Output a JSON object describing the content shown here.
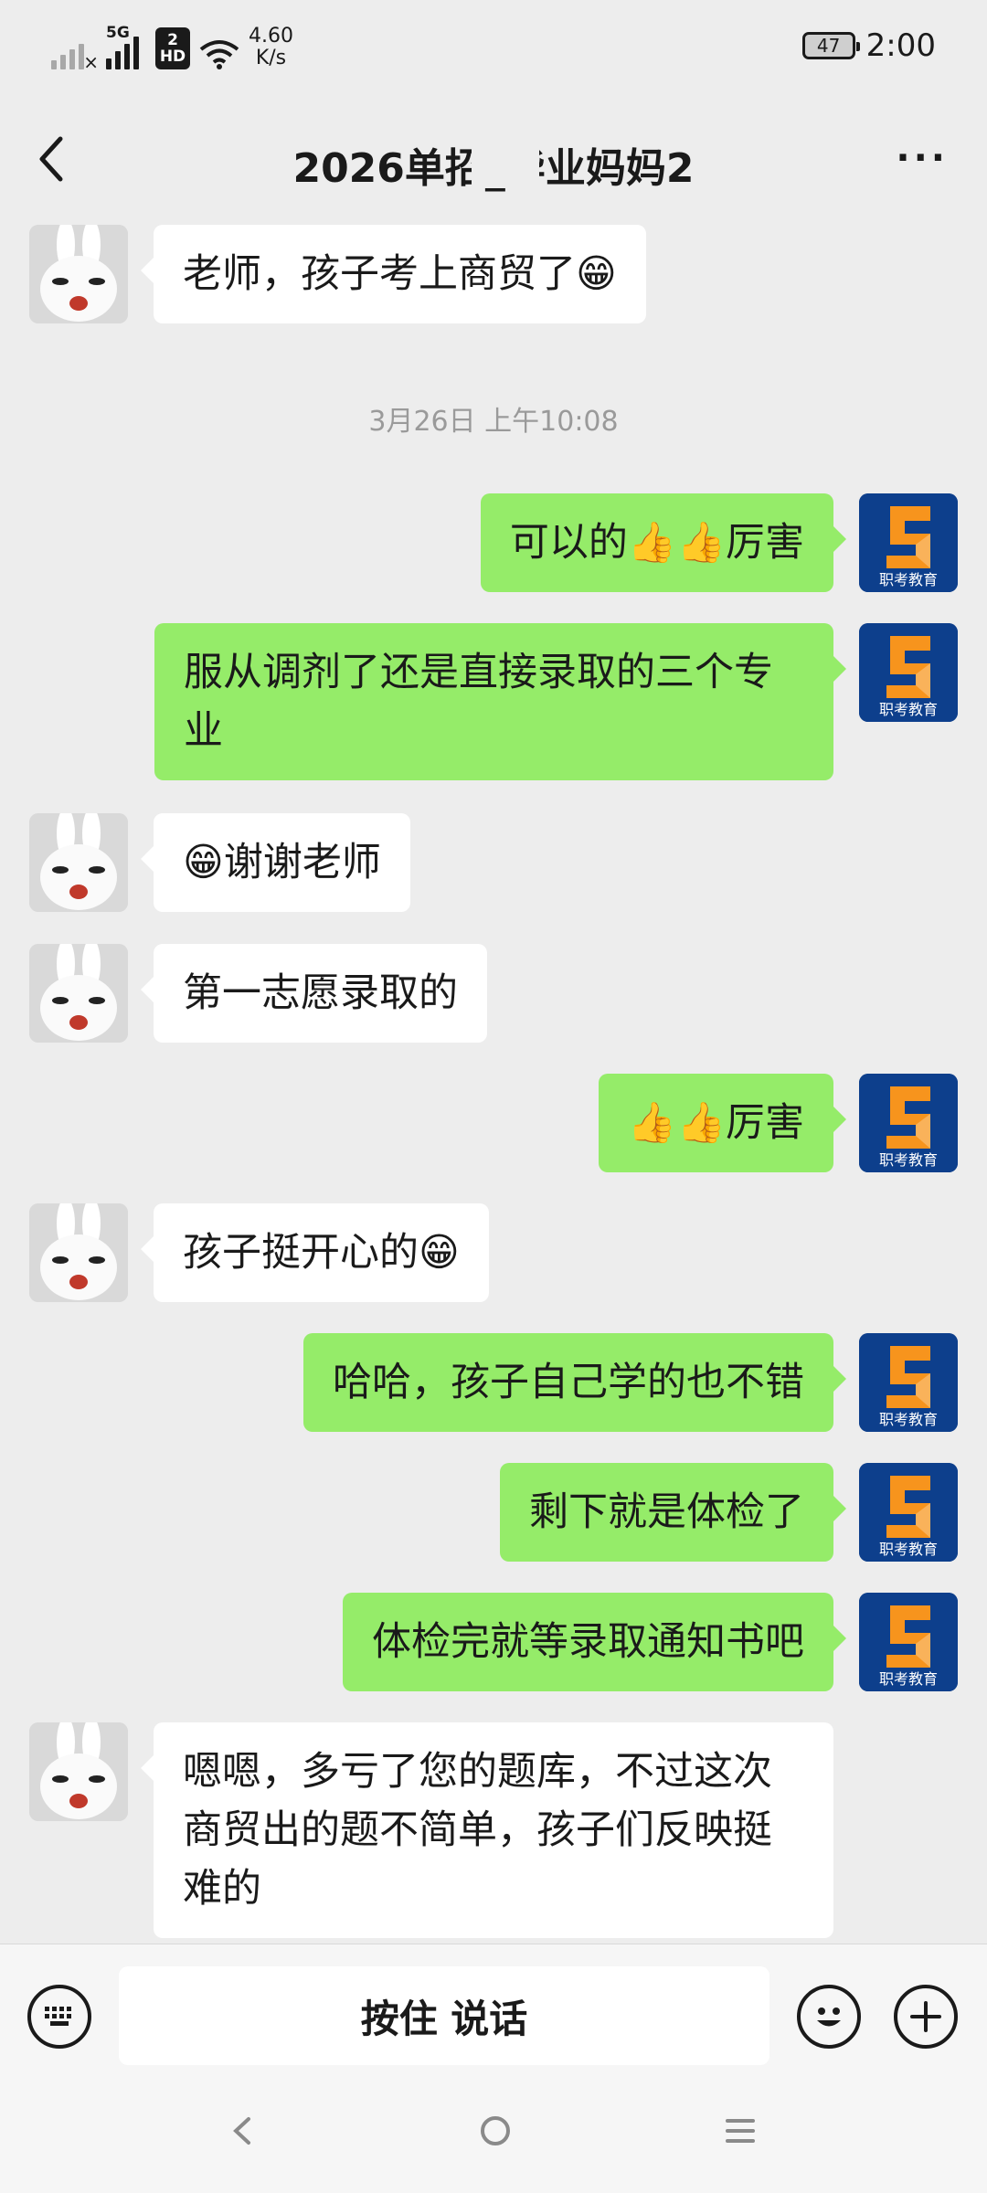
{
  "status_bar": {
    "network_type": "5G",
    "hd_badge_top": "2",
    "hd_badge_bottom": "HD",
    "speed_value": "4.60",
    "speed_unit": "K/s",
    "battery": "47",
    "time": "2:00"
  },
  "header": {
    "title": "2026单招_毕业妈妈2",
    "back_icon": "chevron-left-icon",
    "more_icon": "more-dots-icon"
  },
  "chat": {
    "messages": [
      {
        "side": "in",
        "text": "老师，孩子考上商贸了😁"
      },
      {
        "type": "time",
        "text": "3月26日 上午10:08"
      },
      {
        "side": "out",
        "text": "可以的👍👍厉害"
      },
      {
        "side": "out",
        "text": "服从调剂了还是直接录取的三个专业"
      },
      {
        "side": "in",
        "text": "😁谢谢老师"
      },
      {
        "side": "in",
        "text": "第一志愿录取的"
      },
      {
        "side": "out",
        "text": "👍👍厉害"
      },
      {
        "side": "in",
        "text": "孩子挺开心的😁"
      },
      {
        "side": "out",
        "text": "哈哈，孩子自己学的也不错"
      },
      {
        "side": "out",
        "text": "剩下就是体检了"
      },
      {
        "side": "out",
        "text": "体检完就等录取通知书吧"
      },
      {
        "side": "in",
        "text": "嗯嗯，多亏了您的题库，不过这次商贸出的题不简单，孩子们反映挺难的"
      }
    ],
    "teacher_logo_text": "职考教育",
    "colors": {
      "outgoing_bubble": "#95ec69",
      "incoming_bubble": "#ffffff",
      "background": "#ededed",
      "logo_bg": "#0d3f8c",
      "logo_orange": "#f7941d"
    }
  },
  "input_bar": {
    "keyboard_icon": "keyboard-icon",
    "hold_to_talk": "按住 说话",
    "emoji_icon": "emoji-icon",
    "plus_icon": "plus-icon"
  },
  "nav_bar": {
    "back_icon": "nav-back-icon",
    "home_icon": "nav-home-icon",
    "menu_icon": "nav-menu-icon"
  }
}
